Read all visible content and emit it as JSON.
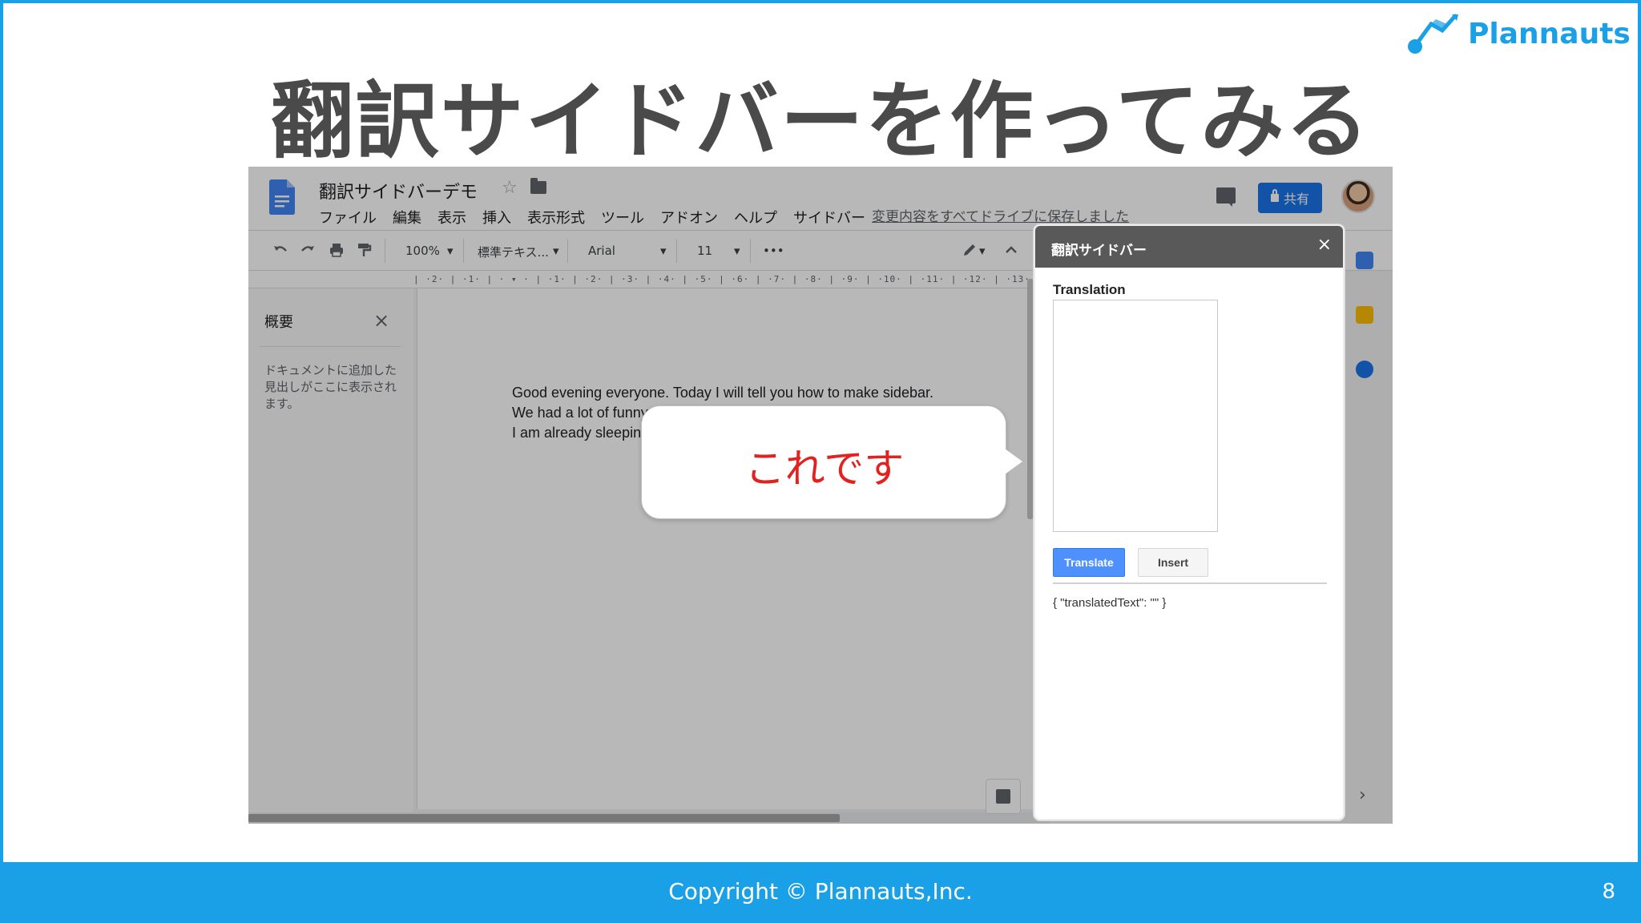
{
  "slide": {
    "title": "翻訳サイドバーを作ってみる",
    "brand": "Plannauts",
    "copyright": "Copyright ©  Plannauts,Inc.",
    "page_number": "8",
    "colors": {
      "accent": "#1aa0e6",
      "title": "#4a4a4a",
      "callout_text": "#e3211f"
    }
  },
  "docs": {
    "doc_title": "翻訳サイドバーデモ",
    "menu": [
      "ファイル",
      "編集",
      "表示",
      "挿入",
      "表示形式",
      "ツール",
      "アドオン",
      "ヘルプ",
      "サイドバー"
    ],
    "save_status": "変更内容をすべてドライブに保存しました",
    "share_label": "共有",
    "toolbar": {
      "zoom": "100%",
      "style": "標準テキス...",
      "font": "Arial",
      "font_size": "11",
      "more": "•••"
    },
    "ruler": "| ·2· | ·1· | · ▾ · | ·1· | ·2· | ·3· | ·4· | ·5· | ·6· | ·7· | ·8· | ·9· | ·10· | ·11· | ·12· | ·13· | ·14",
    "outline": {
      "title": "概要",
      "hint": "ドキュメントに追加した見出しがここに表示されます。"
    },
    "body_lines": [
      "Good evening everyone. Today I will tell you how to make sidebar.",
      "We had a lot of funny",
      "I am already sleepin"
    ]
  },
  "sidebar": {
    "title": "翻訳サイドバー",
    "close": "×",
    "translation_label": "Translation",
    "textarea_value": "",
    "translate_button": "Translate",
    "insert_button": "Insert",
    "result": "{ \"translatedText\": \"\" }",
    "colors": {
      "header": "#595959",
      "translate_button": "#4d90fe"
    }
  },
  "callout": {
    "text": "これです"
  },
  "icons": [
    "docs-logo-icon",
    "star-icon",
    "folder-icon",
    "comments-icon",
    "lock-icon",
    "undo-icon",
    "redo-icon",
    "print-icon",
    "paint-format-icon",
    "pencil-icon",
    "chevron-up-icon",
    "close-icon",
    "explore-icon",
    "calendar-icon",
    "keep-icon",
    "tasks-icon",
    "chevron-right-icon"
  ]
}
